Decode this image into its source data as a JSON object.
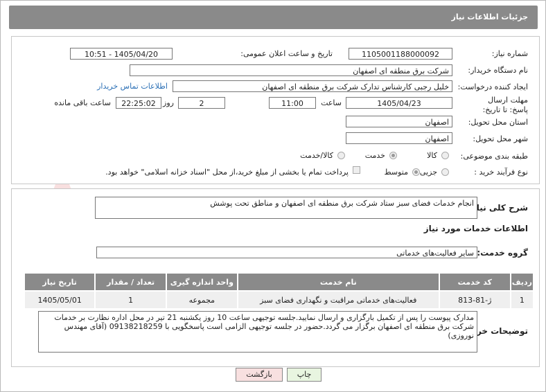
{
  "header": {
    "title": "جزئیات اطلاعات نیاز"
  },
  "fields": {
    "need_number_label": "شماره نیاز:",
    "need_number": "1105001188000092",
    "announce_label": "تاریخ و ساعت اعلان عمومی:",
    "announce_value": "1405/04/20 - 10:51",
    "buyer_org_label": "نام دستگاه خریدار:",
    "buyer_org": "شرکت برق منطقه ای اصفهان",
    "creator_label": "ایجاد کننده درخواست:",
    "creator": "خلیل رجبی کارشناس تدارک شرکت برق منطقه ای اصفهان",
    "contact_link": "اطلاعات تماس خریدار",
    "deadline_label": "مهلت ارسال پاسخ: تا تاریخ:",
    "deadline_date": "1405/04/23",
    "hour_label": "ساعت",
    "deadline_hour": "11:00",
    "days_value": "2",
    "days_label": "روز و",
    "remaining_value": "22:25:02",
    "remaining_label": "ساعت باقی مانده",
    "province_label": "استان محل تحویل:",
    "province": "اصفهان",
    "city_label": "شهر محل تحویل:",
    "city": "اصفهان",
    "category_label": "طبقه بندی موضوعی:",
    "category_options": [
      "کالا",
      "خدمت",
      "کالا/خدمت"
    ],
    "process_label": "نوع فرآیند خرید :",
    "process_options": [
      "جزیی",
      "متوسط"
    ],
    "payment_note": "پرداخت تمام یا بخشی از مبلغ خرید،از محل \"اسناد خزانه اسلامی\" خواهد بود."
  },
  "summary": {
    "label": "شرح کلی نیاز:",
    "text": "انجام خدمات فضای سبز  ستاد شرکت برق منطقه ای اصفهان و مناطق تحت پوشش"
  },
  "services": {
    "section_title": "اطلاعات خدمات مورد نیاز",
    "group_label": "گروه خدمت:",
    "group_value": "سایر فعالیت‌های خدماتی",
    "columns": [
      "ردیف",
      "کد خدمت",
      "نام خدمت",
      "واحد اندازه گیری",
      "تعداد / مقدار",
      "تاریخ نیاز"
    ],
    "rows": [
      [
        "1",
        "ژ-81-813",
        "فعالیت‌های خدماتی مراقبت و نگهداری فضای سبز",
        "مجموعه",
        "1",
        "1405/05/01"
      ]
    ]
  },
  "buyer_notes": {
    "label": "توضیحات خریدار:",
    "text": "مدارک پیوست را پس از تکمیل بارگزاری و ارسال نمایید.جلسه توجیهی ساعت 10 روز یکشنبه 21 تیر در محل اداره نظارت بر خدمات شرکت برق منطقه ای اصفهان برگزار می گردد.حضور در جلسه توجیهی الزامی است پاسخگویی با 09138218259 (آقای مهندس نوروزی)"
  },
  "buttons": {
    "print": "چاپ",
    "back": "بازگشت"
  },
  "watermark": "AriaTender.net"
}
